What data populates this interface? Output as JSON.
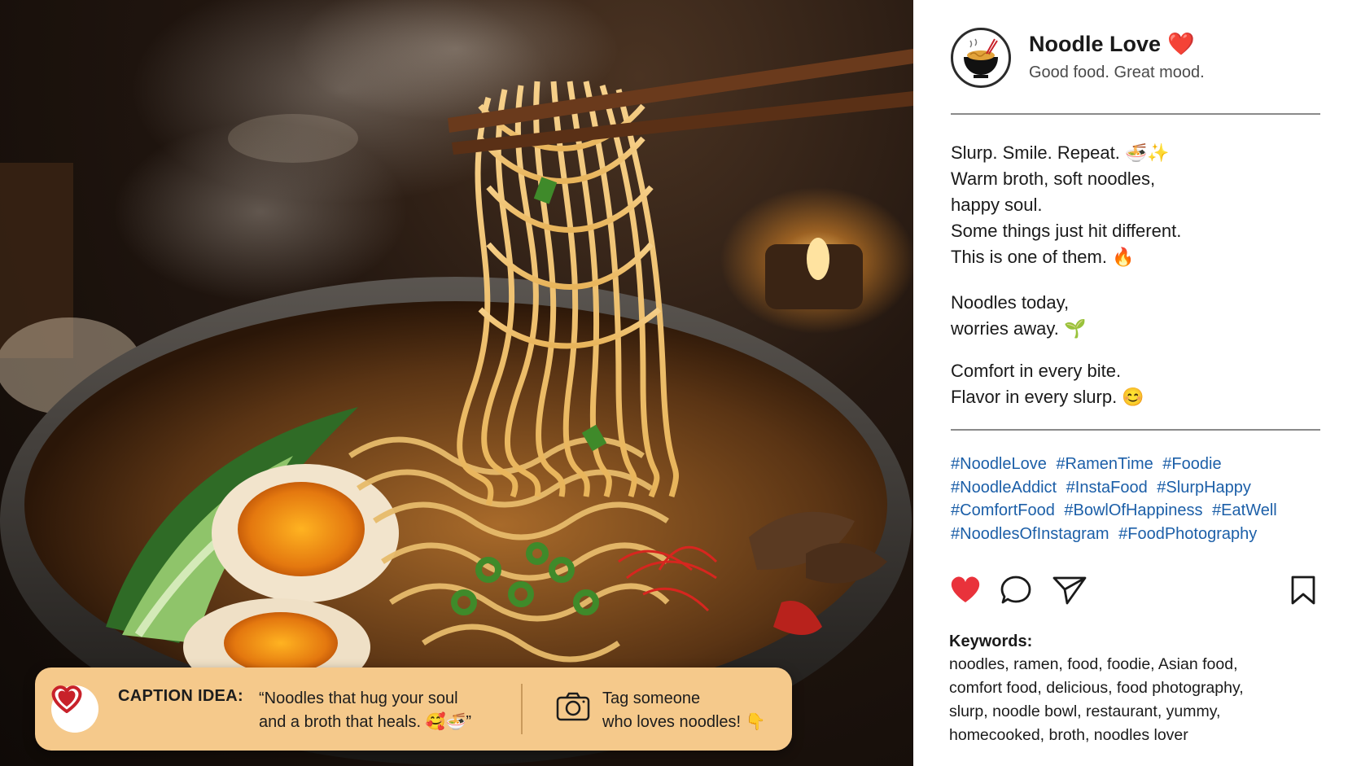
{
  "post": {
    "profile": {
      "name": "Noodle Love",
      "heart": "❤️",
      "tagline": "Good food. Great mood."
    },
    "caption_lines_1": [
      "Slurp. Smile. Repeat. 🍜✨",
      "Warm broth, soft noodles,",
      "happy soul.",
      "Some things just hit different.",
      "This is one of them. 🔥"
    ],
    "caption_lines_2": [
      "Noodles today,",
      "worries away. 🌱"
    ],
    "caption_lines_3": [
      "Comfort in every bite.",
      "Flavor in every slurp. 😊"
    ],
    "hashtags": [
      "#NoodleLove",
      "#RamenTime",
      "#Foodie",
      "#NoodleAddict",
      "#InstaFood",
      "#SlurpHappy",
      "#ComfortFood",
      "#BowlOfHappiness",
      "#EatWell",
      "#NoodlesOfInstagram",
      "#FoodPhotography"
    ],
    "actions": {
      "like_icon": "heart-filled-icon",
      "comment_icon": "comment-bubble-icon",
      "share_icon": "paper-plane-icon",
      "save_icon": "bookmark-icon",
      "like_color": "#e9323b"
    },
    "keywords": {
      "title": "Keywords:",
      "text": "noodles, ramen, food, foodie, Asian food,\ncomfort food, delicious, food photography,\nslurp, noodle bowl, restaurant, yummy,\nhomecooked, broth, noodles lover"
    }
  },
  "caption_bar": {
    "label": "CAPTION IDEA:",
    "idea": "“Noodles that hug your soul\nand a broth that heals. 🥰🍜”",
    "tag_text": "Tag someone\nwho loves noodles! 👇",
    "background": "#f5c98b"
  },
  "colors": {
    "hashtag": "#1c5fa8",
    "heart": "#e2282f"
  }
}
